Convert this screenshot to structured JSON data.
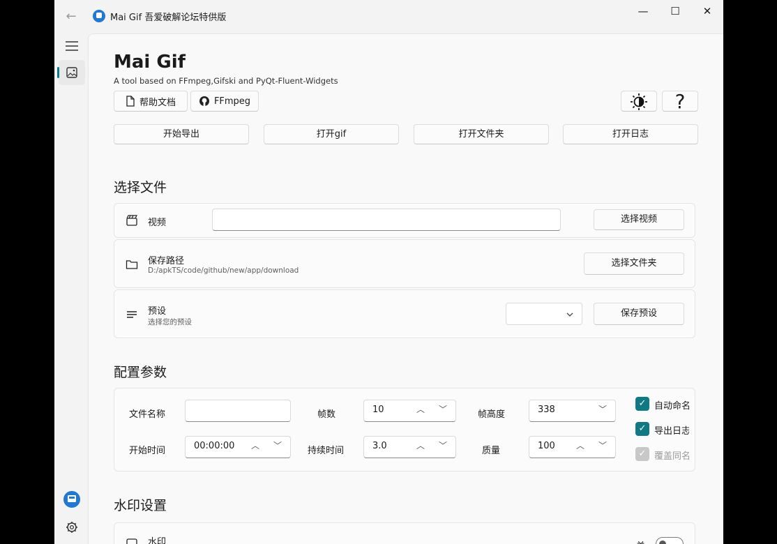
{
  "window": {
    "title": "Mai Gif  吾爱破解论坛特供版",
    "controls": {
      "minimize": "—",
      "maximize": "☐",
      "close": "✕"
    }
  },
  "header": {
    "title": "Mai Gif",
    "subtitle": "A tool based on FFmpeg,Gifski and PyQt-Fluent-Widgets",
    "help_label": "帮助文档",
    "ffmpeg_label": "FFmpeg"
  },
  "actions": {
    "export": "开始导出",
    "open_gif": "打开gif",
    "open_folder": "打开文件夹",
    "open_log": "打开日志"
  },
  "select_files": {
    "heading": "选择文件",
    "video": {
      "label": "视频",
      "value": "",
      "button": "选择视频"
    },
    "save_path": {
      "label": "保存路径",
      "path": "D:/apkTS/code/github/new/app/download",
      "button": "选择文件夹"
    },
    "preset": {
      "label": "预设",
      "hint": "选择您的预设",
      "selected": "",
      "button": "保存预设"
    }
  },
  "config": {
    "heading": "配置参数",
    "filename_label": "文件名称",
    "filename_value": "",
    "frames_label": "帧数",
    "frames_value": "10",
    "height_label": "帧高度",
    "height_value": "338",
    "start_label": "开始时间",
    "start_value": "00:00:00",
    "duration_label": "持续时间",
    "duration_value": "3.0",
    "quality_label": "质量",
    "quality_value": "100",
    "auto_name": "自动命名",
    "export_log": "导出日志",
    "overwrite": "覆盖同名"
  },
  "watermark": {
    "heading": "水印设置",
    "label": "水印",
    "toggle_state": "关"
  },
  "colors": {
    "accent": "#0f7a86",
    "app_icon": "#1e78d4"
  }
}
